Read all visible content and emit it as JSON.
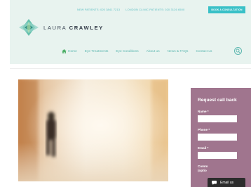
{
  "header": {
    "new_patients": "NEW PATIENTS: 020 3841 7213",
    "london_clinic": "LONDON CLINIC PATIENTS: 020 3126 6500",
    "cta_label": "BOOK A CONSULTATION",
    "logo_first": "LAURA",
    "logo_last": "CRAWLEY",
    "colors": {
      "header_bg": "#e8f3ef",
      "accent": "#39c0c7",
      "nav": "#5db7b0"
    }
  },
  "nav": {
    "items": [
      "Home",
      "Eye Treatments",
      "Eye Conditions",
      "About us",
      "News & FAQs",
      "Contact us"
    ],
    "home_icon": "home-icon",
    "search_icon": "search-icon"
  },
  "sidebar": {
    "title": "Request call back",
    "fields": [
      "Name *",
      "Phone *",
      "Email *"
    ],
    "comments_label_1": "Comm",
    "comments_label_2": "(optio",
    "bg_color": "#a0758e"
  },
  "email_chip": {
    "label": "Email us",
    "icon": "chat-icon"
  }
}
